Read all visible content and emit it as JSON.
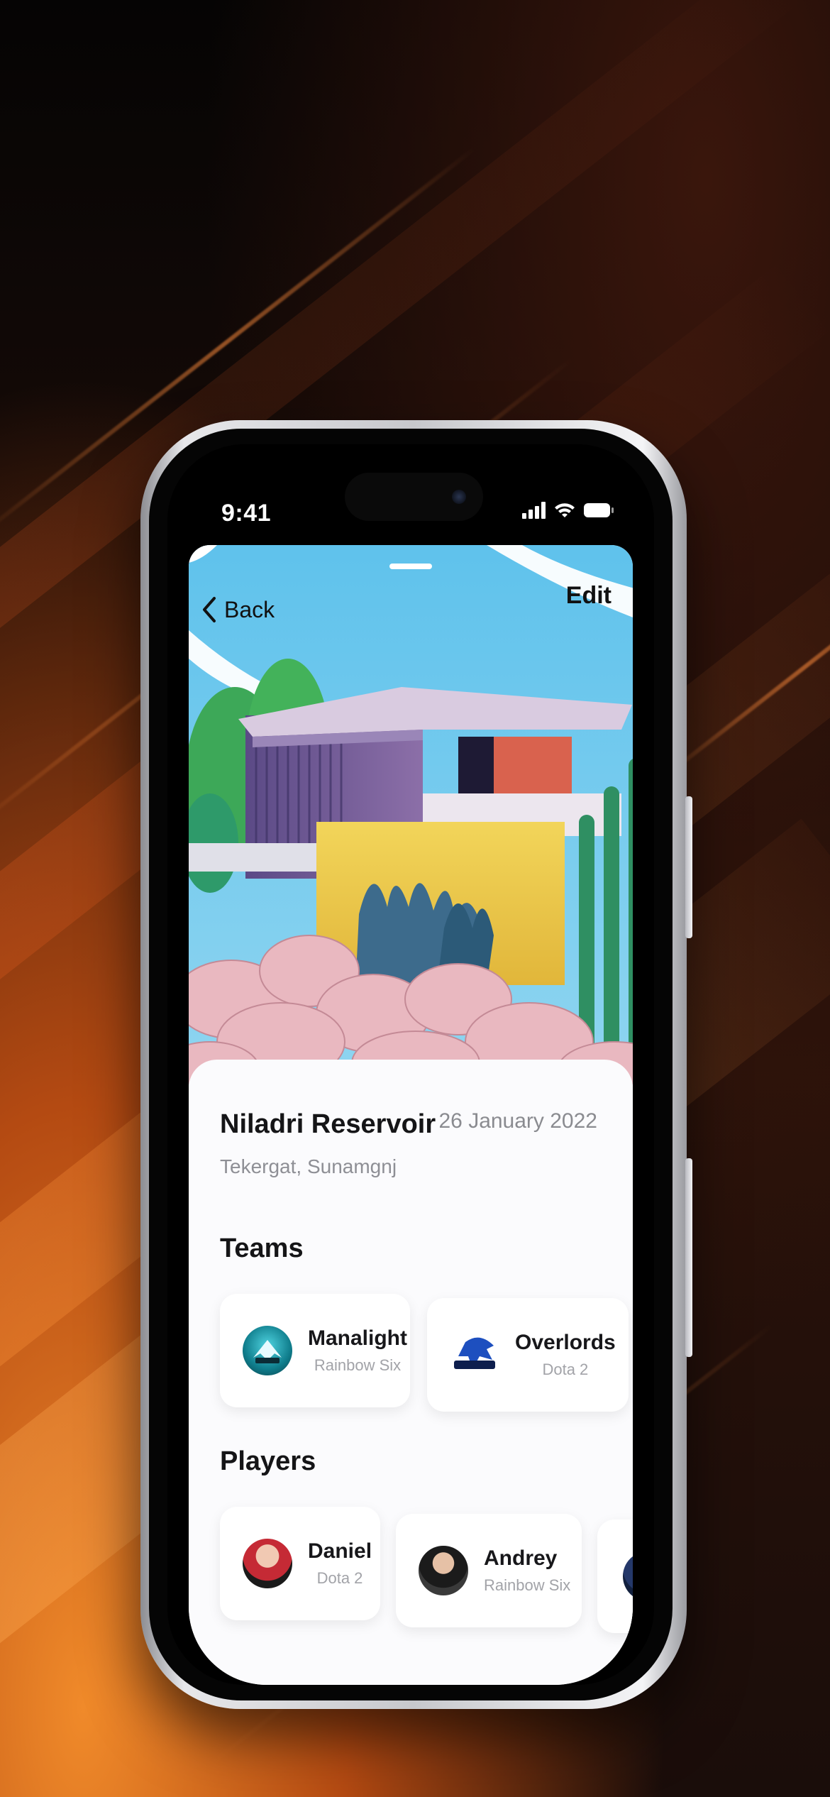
{
  "status": {
    "time": "9:41"
  },
  "nav": {
    "back_label": "Back",
    "edit_label": "Edit"
  },
  "event": {
    "venue": "Niladri Reservoir",
    "date": "26 January 2022",
    "location": "Tekergat, Sunamgnj"
  },
  "teams": {
    "title": "Teams",
    "items": [
      {
        "name": "Manalight",
        "game": "Rainbow Six"
      },
      {
        "name": "Overlords",
        "game": "Dota 2"
      }
    ]
  },
  "players": {
    "title": "Players",
    "items": [
      {
        "name": "Daniel",
        "game": "Dota 2"
      },
      {
        "name": "Andrey",
        "game": "Rainbow Six"
      }
    ]
  },
  "colors": {
    "accent_orange": "#f08a2a",
    "sky": "#6cc3ea",
    "sheet": "#fbfbfd"
  },
  "icons": [
    "chevron-left-icon",
    "cellular-icon",
    "wifi-icon",
    "battery-icon"
  ]
}
